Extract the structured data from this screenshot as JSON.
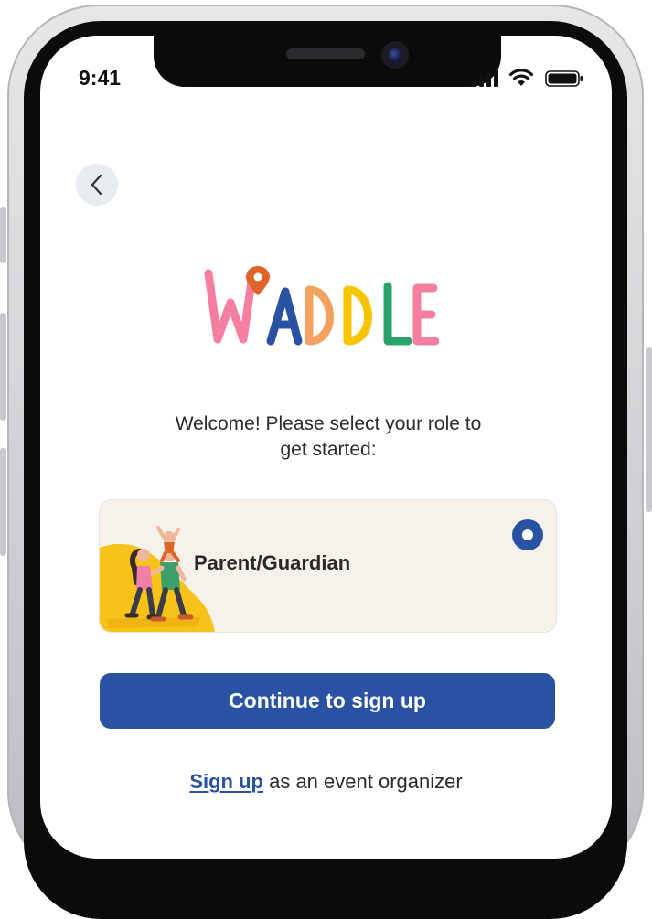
{
  "status_bar": {
    "time": "9:41",
    "icons": [
      "cellular-signal-icon",
      "wifi-icon",
      "battery-icon"
    ]
  },
  "nav": {
    "back_icon": "chevron-left-icon"
  },
  "logo": {
    "text": "WADDLE",
    "letter_colors": [
      "#f47fa1",
      "#f47fa1",
      "#2952a3",
      "#f2a15f",
      "#f6c400",
      "#2aa36b",
      "#f47fa1"
    ],
    "pin_color": "#e0632a"
  },
  "welcome": {
    "line1": "Welcome! Please select your role to",
    "line2": "get started:"
  },
  "role_option": {
    "label": "Parent/Guardian",
    "selected": true,
    "illustration": "family-walking-illustration"
  },
  "cta": {
    "label": "Continue to sign up"
  },
  "footer": {
    "link_text": "Sign up",
    "rest_text": "as an event organizer"
  },
  "colors": {
    "primary": "#2952a3",
    "card_bg": "#f6f1ea",
    "back_bg": "#e8ebf0",
    "blob_yellow": "#f7c21a"
  }
}
